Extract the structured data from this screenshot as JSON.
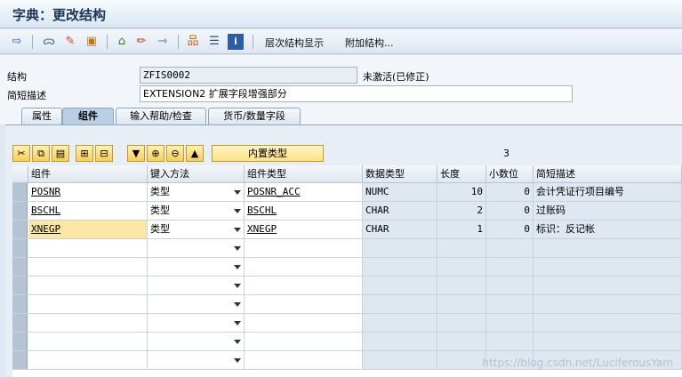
{
  "window": {
    "title": "字典：更改结构"
  },
  "toolbar": {
    "icons": [
      "arrow-right-icon",
      "glasses-icon",
      "display-change-icon",
      "activate-icon",
      "hierarchy-icon",
      "pencil-icon",
      "where-used-icon",
      "object-list-icon",
      "technical-settings-icon",
      "info-icon"
    ],
    "hierarchy_display": "层次结构显示",
    "append_structure": "附加结构..."
  },
  "form": {
    "structure_label": "结构",
    "structure_value": "ZFIS0002",
    "status": "未激活(已修正)",
    "short_desc_label": "简短描述",
    "short_desc_value": "EXTENSION2 扩展字段增强部分"
  },
  "tabs": [
    {
      "label": "属性",
      "active": false
    },
    {
      "label": "组件",
      "active": true
    },
    {
      "label": "输入帮助/检查",
      "active": false
    },
    {
      "label": "货币/数量字段",
      "active": false
    }
  ],
  "grid_toolbar": {
    "icons": [
      "cut-icon",
      "copy-icon",
      "paste-icon",
      "insert-row-icon",
      "delete-row-icon",
      "down-icon",
      "expand-icon",
      "collapse-icon",
      "up-icon"
    ],
    "builtin_type": "内置类型",
    "count": "3"
  },
  "table": {
    "columns": [
      "组件",
      "键入方法",
      "组件类型",
      "数据类型",
      "长度",
      "小数位",
      "简短描述"
    ],
    "rows": [
      {
        "component": "POSNR",
        "method": "类型",
        "comp_type": "POSNR_ACC",
        "data_type": "NUMC",
        "length": "10",
        "decimals": "0",
        "desc": "会计凭证行项目编号"
      },
      {
        "component": "BSCHL",
        "method": "类型",
        "comp_type": "BSCHL",
        "data_type": "CHAR",
        "length": "2",
        "decimals": "0",
        "desc": "过账码"
      },
      {
        "component": "XNEGP",
        "method": "类型",
        "comp_type": "XNEGP",
        "data_type": "CHAR",
        "length": "1",
        "decimals": "0",
        "desc": "标识：反记帐"
      }
    ]
  },
  "watermark": "https://blog.csdn.net/LuciferousYam"
}
